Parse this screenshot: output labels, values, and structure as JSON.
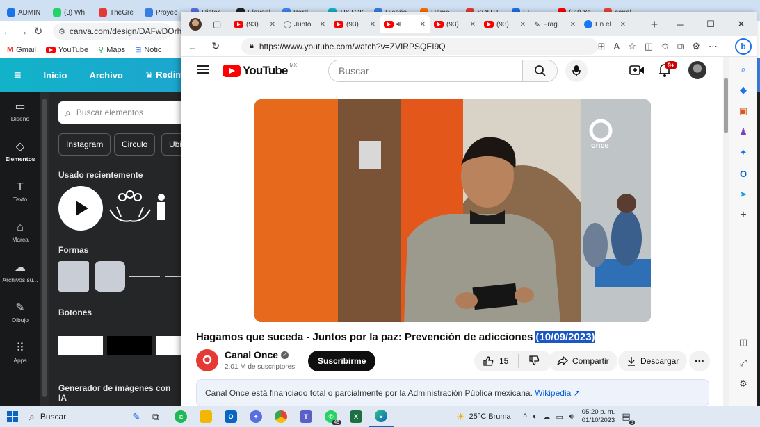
{
  "back_browser": {
    "tabs": [
      {
        "label": "ADMIN",
        "color": "#1a73e8"
      },
      {
        "label": "(3) Wh",
        "color": "#25d366"
      },
      {
        "label": "TheGre",
        "color": "#e53935"
      },
      {
        "label": "Proyec",
        "color": "#3a7de0"
      },
      {
        "label": "Histor",
        "color": "#5b6ee1"
      },
      {
        "label": "Elevenl",
        "color": "#222222"
      },
      {
        "label": "Bard",
        "color": "#4285f4"
      },
      {
        "label": "TIKTOK",
        "color": "#12b3c9"
      },
      {
        "label": "Diseño",
        "color": "#3a7de0"
      },
      {
        "label": "Home",
        "color": "#ff6d00"
      },
      {
        "label": "YOUTI",
        "color": "#e53935"
      },
      {
        "label": "EL",
        "color": "#1a73e8"
      },
      {
        "label": "(93) Yo",
        "color": "#ff0000"
      },
      {
        "label": "canal",
        "color": "#ea4335"
      }
    ],
    "url": "canva.com/design/DAFwDOrh",
    "bookmarks": [
      "Gmail",
      "YouTube",
      "Maps",
      "Notic"
    ],
    "canva_menu": [
      "Inicio",
      "Archivo",
      "Redimen"
    ],
    "rail": [
      {
        "label": "Diseño",
        "icon": "layout-icon",
        "glyph": "▭"
      },
      {
        "label": "Elementos",
        "icon": "elements-icon",
        "glyph": "◇"
      },
      {
        "label": "Texto",
        "icon": "text-icon",
        "glyph": "T"
      },
      {
        "label": "Marca",
        "icon": "brand-icon",
        "glyph": "⌂"
      },
      {
        "label": "Archivos su...",
        "icon": "upload-icon",
        "glyph": "☁"
      },
      {
        "label": "Dibujo",
        "icon": "draw-icon",
        "glyph": "✎"
      },
      {
        "label": "Apps",
        "icon": "apps-icon",
        "glyph": "⠿"
      }
    ],
    "panel": {
      "search_placeholder": "Buscar elementos",
      "chips": [
        "Instagram",
        "Circulo",
        "Ubi"
      ],
      "recent_heading": "Usado recientemente",
      "shapes_heading": "Formas",
      "buttons_heading": "Botones",
      "ai_heading": "Generador de imágenes con IA"
    }
  },
  "edge": {
    "tabs": [
      {
        "label": "",
        "kind": "profile"
      },
      {
        "label": "",
        "kind": "workspaces"
      },
      {
        "label": "(93)",
        "kind": "yt"
      },
      {
        "label": "Junto",
        "kind": "blank"
      },
      {
        "label": "(93)",
        "kind": "yt"
      },
      {
        "label": "",
        "kind": "yt-active"
      },
      {
        "label": "(93)",
        "kind": "yt"
      },
      {
        "label": "(93)",
        "kind": "yt"
      },
      {
        "label": "Frag",
        "kind": "frag"
      },
      {
        "label": "En el",
        "kind": "fb"
      }
    ],
    "url": "https://www.youtube.com/watch?v=ZVIRPSQEI9Q"
  },
  "youtube": {
    "logo_text": "YouTube",
    "country": "MX",
    "search_placeholder": "Buscar",
    "notification_count": "9+",
    "video_watermark": "once",
    "title_main": "Hagamos que suceda - Juntos por la paz: Prevención de adicciones ",
    "title_selected": "(10/09/2023)",
    "channel_name": "Canal Once",
    "subscribers": "2,01 M de suscriptores",
    "subscribe_label": "Suscribirme",
    "likes": "15",
    "share_label": "Compartir",
    "download_label": "Descargar",
    "info_text": "Canal Once está financiado total o parcialmente por la Administración Pública mexicana. ",
    "info_link": "Wikipedia"
  },
  "taskbar": {
    "search_label": "Buscar",
    "whatsapp_badge": "49",
    "weather": "25°C  Bruma",
    "time": "05:20 p. m.",
    "date": "01/10/2023",
    "notifications": "5"
  }
}
